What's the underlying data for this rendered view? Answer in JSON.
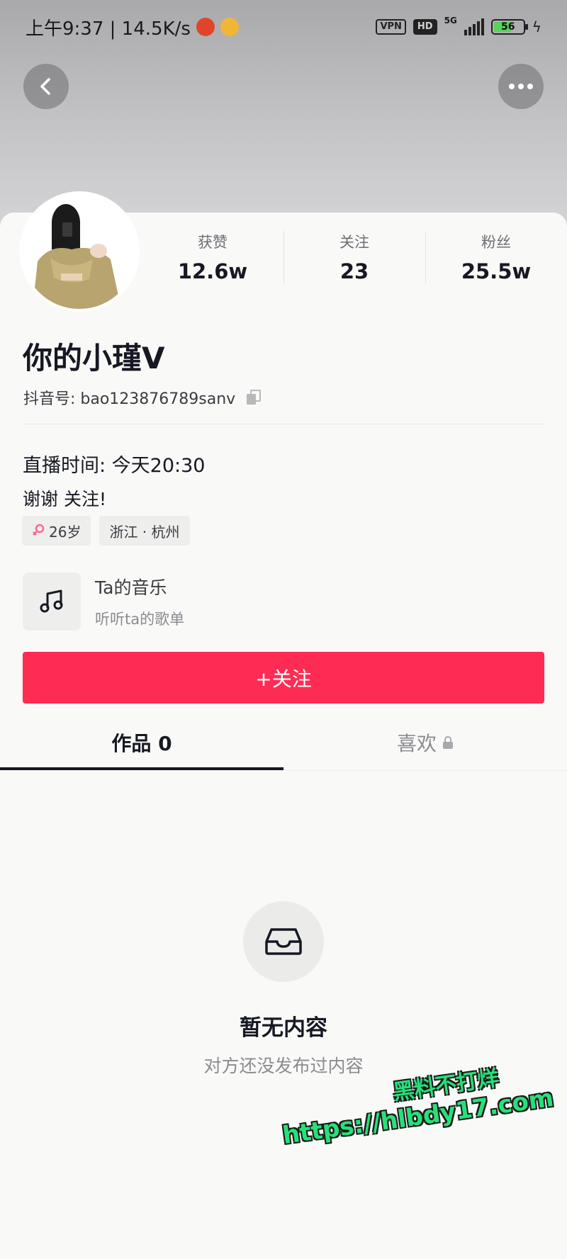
{
  "status_bar": {
    "time_speed": "上午9:37 | 14.5K/s",
    "vpn": "VPN",
    "hd": "HD",
    "network": "5G",
    "battery": "56"
  },
  "stats": [
    {
      "label": "获赞",
      "value": "12.6w"
    },
    {
      "label": "关注",
      "value": "23"
    },
    {
      "label": "粉丝",
      "value": "25.5w"
    }
  ],
  "profile": {
    "name": "你的小瑾V",
    "douyin_id": "抖音号: bao123876789sanv"
  },
  "bio": {
    "line1": "直播时间: 今天20:30",
    "line2": "谢谢 关注!"
  },
  "tags": {
    "age": "26岁",
    "location": "浙江 · 杭州"
  },
  "music": {
    "title": "Ta的音乐",
    "subtitle": "听听ta的歌单"
  },
  "follow_button": "+关注",
  "tabs": {
    "works": "作品 0",
    "likes": "喜欢"
  },
  "empty_state": {
    "title": "暂无内容",
    "subtitle": "对方还没发布过内容"
  },
  "watermark": {
    "line1": "黑料不打烊",
    "line2": "https://hlbdy17.com"
  },
  "colors": {
    "accent": "#fe2c55",
    "watermark": "#27e07a"
  },
  "icons": [
    "back-icon",
    "more-icon",
    "copy-icon",
    "female-icon",
    "music-note-icon",
    "lock-icon",
    "inbox-icon"
  ]
}
